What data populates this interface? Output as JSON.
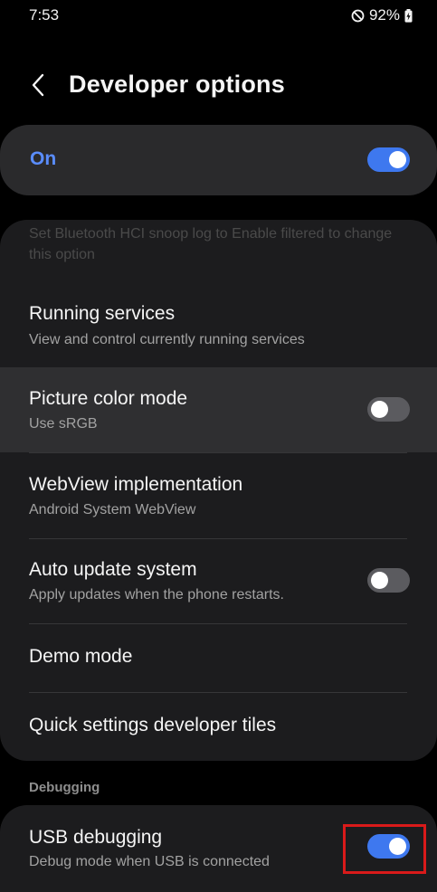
{
  "status_bar": {
    "time": "7:53",
    "battery": "92%",
    "icons": [
      "do-not-disturb-icon",
      "battery-charging-icon"
    ]
  },
  "header": {
    "title": "Developer options",
    "back_icon": "chevron-left-icon"
  },
  "master_switch": {
    "label": "On",
    "checked": true
  },
  "settings": {
    "note": "Set Bluetooth HCI snoop log to Enable filtered to change this option",
    "items": [
      {
        "title": "Running services",
        "subtitle": "View and control currently running services"
      },
      {
        "title": "Picture color mode",
        "subtitle": "Use sRGB",
        "toggle": false
      },
      {
        "title": "WebView implementation",
        "subtitle": "Android System WebView"
      },
      {
        "title": "Auto update system",
        "subtitle": "Apply updates when the phone restarts.",
        "toggle": false
      },
      {
        "title": "Demo mode"
      },
      {
        "title": "Quick settings developer tiles"
      }
    ]
  },
  "debugging": {
    "section_label": "Debugging",
    "usb_debugging": {
      "title": "USB debugging",
      "subtitle": "Debug mode when USB is connected",
      "checked": true
    }
  },
  "colors": {
    "background": "#000000",
    "card": "#1c1c1e",
    "accent": "#3e78ef",
    "accent_text": "#5a8dff",
    "highlight_box": "#d91a1a"
  }
}
